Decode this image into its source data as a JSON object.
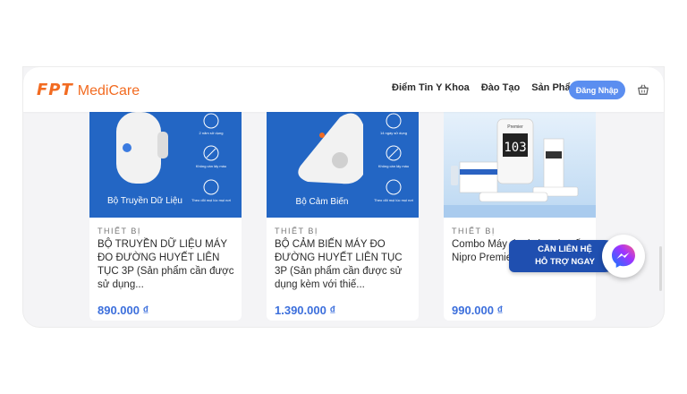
{
  "brand": {
    "fpt": "FPT",
    "medicare": "MediCare"
  },
  "nav": {
    "items": [
      "Điểm Tin Y Khoa",
      "Đào Tạo",
      "Sản Phẩm"
    ],
    "login_label": "Đăng Nhập"
  },
  "products": [
    {
      "image_caption": "Bộ Truyền Dữ Liệu",
      "category": "THIẾT BỊ",
      "title": "BỘ TRUYỀN DỮ LIỆU MÁY ĐO ĐƯỜNG HUYẾT LIÊN TỤC 3P (Sản phẩm cần được sử dụng...",
      "price": "890.000 ₫",
      "badges": [
        "2 năm sử dụng",
        "Không cần lấy máu",
        "Theo dõi mọi lúc mọi nơi"
      ]
    },
    {
      "image_caption": "Bộ Cảm Biến",
      "category": "THIẾT BỊ",
      "title": "BỘ CẢM BIẾN MÁY ĐO ĐƯỜNG HUYẾT LIÊN TỤC 3P (Sản phẩm cần được sử dụng kèm với thiế...",
      "price": "1.390.000 ₫",
      "badges": [
        "14 ngày sử dụng",
        "Không cần lấy máu",
        "Theo dõi mọi lúc mọi nơi"
      ]
    },
    {
      "image_caption": "",
      "category": "THIẾT BỊ",
      "title": "Combo Máy đo đường huyết Nipro Premier",
      "price": "990.000 ₫",
      "meter_reading": "103",
      "meter_brand": "Premier"
    }
  ],
  "contact": {
    "line1": "CẦN LIÊN HỆ",
    "line2": "HỖ TRỢ NGAY"
  },
  "colors": {
    "brand": "#f26b21",
    "accent": "#5b8ef0",
    "price": "#3c6fdc",
    "card_blue": "#2366c4"
  },
  "icons": [
    "cart-icon",
    "messenger-icon"
  ]
}
